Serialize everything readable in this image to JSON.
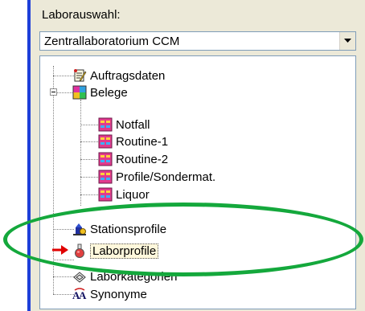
{
  "lab_select": {
    "label": "Laborauswahl:",
    "selected": "Zentrallaboratorium CCM"
  },
  "tree": {
    "items": [
      {
        "label": "Auftragsdaten",
        "icon": "document-edit-icon"
      },
      {
        "label": "Belege",
        "icon": "forms-icon",
        "expanded": true
      },
      {
        "label": "Notfall",
        "icon": "form-icon"
      },
      {
        "label": "Routine-1",
        "icon": "form-icon"
      },
      {
        "label": "Routine-2",
        "icon": "form-icon"
      },
      {
        "label": "Profile/Sondermat.",
        "icon": "form-icon"
      },
      {
        "label": "Liquor",
        "icon": "form-icon"
      },
      {
        "label": "Stationsprofile",
        "icon": "station-profile-icon"
      },
      {
        "label": "Laborprofile",
        "icon": "flask-icon",
        "selected": true
      },
      {
        "label": "Laborkategorien",
        "icon": "categories-icon"
      },
      {
        "label": "Synonyme",
        "icon": "synonyms-icon"
      }
    ]
  },
  "colors": {
    "highlight_ellipse": "#14a83c",
    "arrow": "#e00000",
    "accent_line": "#1e3fd9"
  }
}
